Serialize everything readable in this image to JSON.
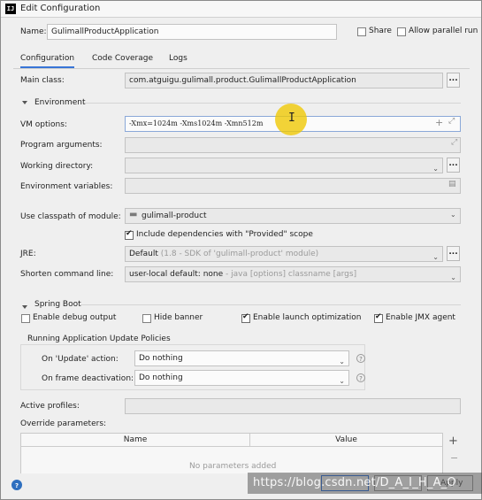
{
  "window": {
    "title": "Edit Configuration",
    "app_icon_text": "IJ"
  },
  "header": {
    "name_label": "Name:",
    "name_value": "GulimallProductApplication",
    "share_label": "Share",
    "allow_parallel_label": "Allow parallel run"
  },
  "tabs": [
    {
      "label": "Configuration",
      "active": true
    },
    {
      "label": "Code Coverage",
      "active": false
    },
    {
      "label": "Logs",
      "active": false
    }
  ],
  "main_class": {
    "label": "Main class:",
    "value": "com.atguigu.gulimall.product.GulimallProductApplication"
  },
  "environment": {
    "section_label": "Environment",
    "vm_options_label": "VM options:",
    "vm_options_value": "-Xmx=1024m -Xms1024m -Xmn512m",
    "program_args_label": "Program arguments:",
    "working_dir_label": "Working directory:",
    "env_vars_label": "Environment variables:"
  },
  "classpath": {
    "label": "Use classpath of module:",
    "module": "gulimall-product",
    "include_deps_label": "Include dependencies with \"Provided\" scope",
    "include_deps_checked": true
  },
  "jre": {
    "label": "JRE:",
    "value": "Default",
    "hint": "(1.8 - SDK of 'gulimall-product' module)"
  },
  "shorten": {
    "label": "Shorten command line:",
    "value": "user-local default: none",
    "hint": "- java [options] classname [args]"
  },
  "spring_boot": {
    "section_label": "Spring Boot",
    "enable_debug_label": "Enable debug output",
    "enable_debug_checked": false,
    "hide_banner_label": "Hide banner",
    "hide_banner_checked": false,
    "launch_opt_label": "Enable launch optimization",
    "launch_opt_checked": true,
    "jmx_label": "Enable JMX agent",
    "jmx_checked": true,
    "policies_label": "Running Application Update Policies",
    "on_update_label": "On 'Update' action:",
    "on_update_value": "Do nothing",
    "on_frame_label": "On frame deactivation:",
    "on_frame_value": "Do nothing",
    "active_profiles_label": "Active profiles:",
    "override_params_label": "Override parameters:",
    "table_cols": [
      "Name",
      "Value"
    ],
    "table_empty_partial": "No parameters added"
  },
  "footer": {
    "help_icon": "?",
    "watermark": "https://blog.csdn.net/D_A_I_H_A_O",
    "apply_label": "Apply"
  },
  "colors": {
    "accent": "#3875d7",
    "highlight": "#f0c800"
  }
}
